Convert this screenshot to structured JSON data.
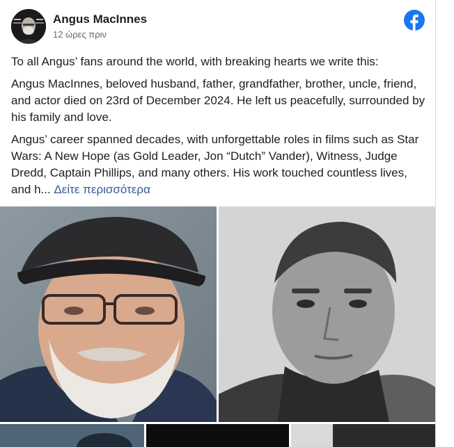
{
  "post": {
    "author": "Angus MacInnes",
    "time": "12 ώρες πριν",
    "paragraphs": [
      "To all Angus’ fans around the world, with breaking hearts we write this:",
      "Angus MacInnes, beloved husband, father, grandfather, brother, uncle, friend, and actor died on 23rd of December 2024. He left us peacefully, surrounded by his family and love.",
      "Angus’ career spanned decades, with unforgettable roles in films such as Star Wars: A New Hope (as Gold Leader, Jon “Dutch” Vander), Witness, Judge Dredd, Captain Phillips, and many others. His work touched countless lives, and h..."
    ],
    "see_more": "Δείτε περισσότερα"
  },
  "icons": {
    "platform": "facebook-icon",
    "avatar": "avatar"
  },
  "colors": {
    "facebook_blue": "#1877f2",
    "link": "#385898",
    "secondary_text": "#65676b"
  }
}
